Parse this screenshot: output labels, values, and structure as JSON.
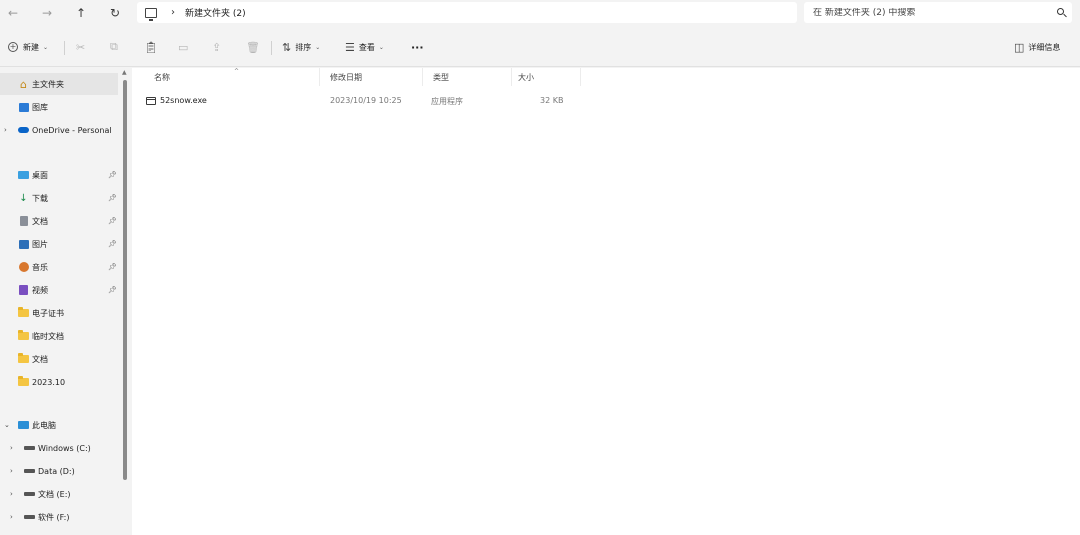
{
  "nav": {
    "back": "←",
    "forward": "→",
    "up": "↑",
    "refresh": "↻"
  },
  "address": {
    "separator": "›",
    "crumb": "新建文件夹 (2)"
  },
  "search": {
    "placeholder": "在 新建文件夹 (2) 中搜索"
  },
  "toolbar": {
    "new_label": "新建",
    "sort_label": "排序",
    "view_label": "查看",
    "more": "···",
    "details_label": "详细信息",
    "icons": [
      "cut-icon",
      "copy-icon",
      "paste-icon",
      "rename-icon",
      "share-icon",
      "delete-icon"
    ]
  },
  "sidebar": {
    "items": [
      {
        "label": "主文件夹",
        "icon": "home-icon",
        "selected": true
      },
      {
        "label": "图库",
        "icon": "gallery-icon"
      },
      {
        "label": "OneDrive - Personal",
        "icon": "cloud-icon",
        "expandable": true
      },
      {
        "label": "桌面",
        "icon": "desktop-icon",
        "pinned": true
      },
      {
        "label": "下载",
        "icon": "download-icon",
        "pinned": true
      },
      {
        "label": "文档",
        "icon": "documents-icon",
        "pinned": true
      },
      {
        "label": "图片",
        "icon": "pictures-icon",
        "pinned": true
      },
      {
        "label": "音乐",
        "icon": "music-icon",
        "pinned": true
      },
      {
        "label": "视频",
        "icon": "video-icon",
        "pinned": true
      },
      {
        "label": "电子证书",
        "icon": "folder-icon"
      },
      {
        "label": "临时文档",
        "icon": "folder-icon"
      },
      {
        "label": "文档",
        "icon": "folder-icon"
      },
      {
        "label": "2023.10",
        "icon": "folder-icon"
      },
      {
        "label": "此电脑",
        "icon": "computer-icon",
        "expandable": true,
        "expanded": true
      },
      {
        "label": "Windows (C:)",
        "icon": "drive-icon",
        "expandable": true
      },
      {
        "label": "Data (D:)",
        "icon": "drive-icon",
        "expandable": true
      },
      {
        "label": "文档 (E:)",
        "icon": "drive-icon",
        "expandable": true
      },
      {
        "label": "软件 (F:)",
        "icon": "drive-icon",
        "expandable": true
      }
    ]
  },
  "columns": {
    "name": "名称",
    "date": "修改日期",
    "type": "类型",
    "size": "大小"
  },
  "files": [
    {
      "name": "52snow.exe",
      "date": "2023/10/19 10:25",
      "type": "应用程序",
      "size": "32 KB"
    }
  ],
  "colors": {
    "accent": "#0067c0",
    "folder": "#f4c542",
    "selected_bg": "#e5e5e5"
  }
}
